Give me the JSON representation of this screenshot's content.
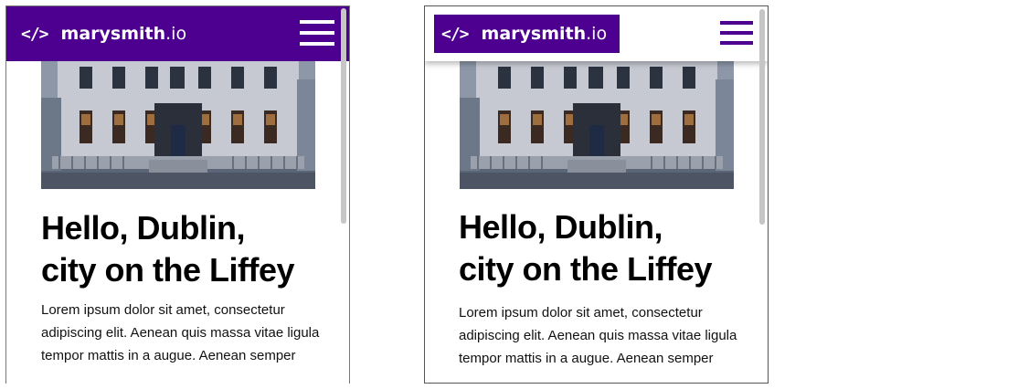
{
  "site": {
    "logo_icon": "</>",
    "logo_name": "marysmith",
    "logo_tld": ".io",
    "menu_icon": "hamburger-menu-icon",
    "brand_color": "#4d0090"
  },
  "hero": {
    "icon": "georgian-mansion-photo"
  },
  "article": {
    "title_line1": "Hello, Dublin,",
    "title_line2": "city on the Liffey",
    "body": "Lorem ipsum dolor sit amet, consectetur adipiscing elit. Aenean quis massa vitae ligula tempor mattis in a augue. Aenean semper"
  }
}
